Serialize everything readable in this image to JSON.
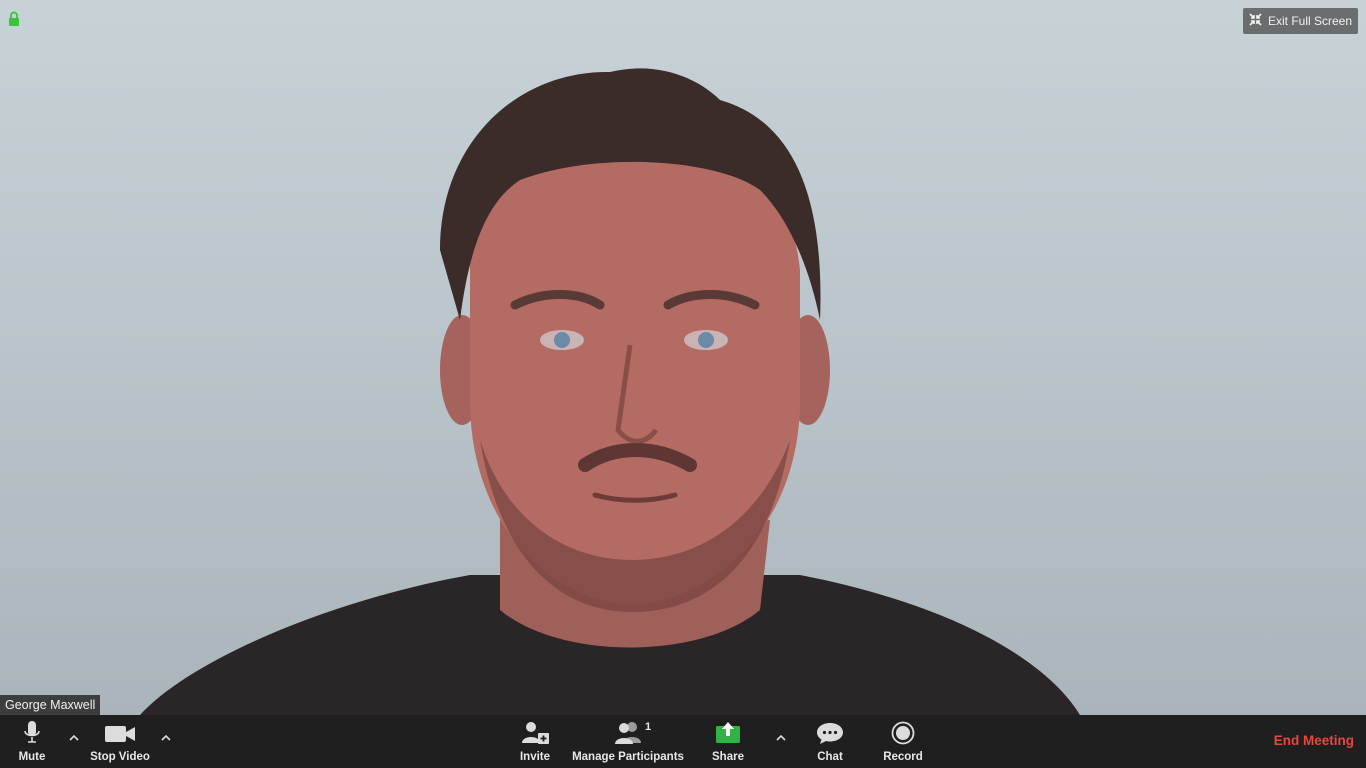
{
  "window": {
    "exit_fullscreen_label": "Exit Full Screen"
  },
  "video": {
    "participant_name": "George Maxwell"
  },
  "toolbar": {
    "mute_label": "Mute",
    "stop_video_label": "Stop Video",
    "invite_label": "Invite",
    "manage_participants_label": "Manage Participants",
    "participant_count": "1",
    "share_label": "Share",
    "chat_label": "Chat",
    "record_label": "Record",
    "end_meeting_label": "End Meeting"
  },
  "colors": {
    "share_green": "#2fb344",
    "end_meeting_red": "#e8463f",
    "toolbar_bg": "#1f1f1f",
    "lock_green": "#3cc23c"
  },
  "icons": {
    "lock": "lock-icon",
    "exit_fullscreen": "collapse-icon",
    "mute": "microphone-icon",
    "video": "camera-icon",
    "invite": "add-person-icon",
    "participants": "people-icon",
    "share": "share-screen-icon",
    "chat": "chat-bubble-icon",
    "record": "record-icon",
    "caret": "chevron-up-icon"
  }
}
